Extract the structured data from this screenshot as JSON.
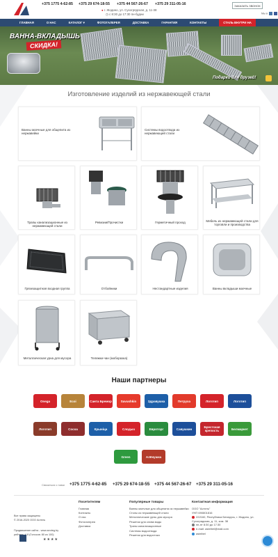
{
  "header": {
    "phones": [
      "+375 1775 4-62-85",
      "+375 29 674-18-55",
      "+375 44 567-26-67",
      "+375 29 311-05-16"
    ],
    "address": "г. Жодино, ул. Сухогрядская, д. 11-38",
    "hours": "с 8:30 до 17:30 пн-будни",
    "callback_label": "ЗАКАЗАТЬ ЗВОНОК",
    "social_label": "Мы в"
  },
  "nav": {
    "items": [
      "ГЛАВНАЯ",
      "О НАС",
      "КАТАЛОГ ▾",
      "ФОТОГАЛЕРЕЯ",
      "ДОСТАВКА",
      "ГАРАНТИЯ",
      "КОНТАКТЫ"
    ],
    "sale": "СТАЛЬ ВНУТРИ НА"
  },
  "hero": {
    "title": "ВАННА-ВКЛАДЫШЬ",
    "badge": "СКИДКА!",
    "gift_text": "Подарки для друзей!"
  },
  "section_title": "Изготовление изделий из нержавеющей стали",
  "products": [
    "Ванны моечные для общепита из нержавейки",
    "Системы водоотвода из нержавеющей стали",
    "Трапы канализационные из нержавеющей стали",
    "Ревизии/Прочистки",
    "Герметичный проход",
    "Мебель из нержавеющей стали для торговли и производства",
    "Грязезащитная входная группа",
    "Отбойники",
    "Нестандартные изделия",
    "Ванны вкладыши моечные",
    "Металлическая урна для мусора",
    "Тележки-чан (моборазка)"
  ],
  "partners_title": "Наши партнеры",
  "partners": [
    "Onega",
    "Ecoi",
    "Санта Бремор",
    "Savushkin",
    "Здравушка",
    "Петруха",
    "Логотип",
    "Логотип",
    "Логотип",
    "Cocoa",
    "Крыніца",
    "Слодыч",
    "Евроторг",
    "Савушкин",
    "Брестская крепость",
    "Белмаркет",
    "Green",
    "Алёнушка"
  ],
  "partner_colors": [
    "#d4232a",
    "#b7843a",
    "#d4232a",
    "#e63a2c",
    "#1d5fa8",
    "#e23a2b",
    "#d4232a",
    "#1d4f9a",
    "#8a3b2a",
    "#8e2d2d",
    "#1d5fa8",
    "#d4232a",
    "#2a8c3e",
    "#1d4f9a",
    "#c4262d",
    "#3a9a3a",
    "#2e9a3e",
    "#b33b2a"
  ],
  "footer": {
    "phones_label": "Связаться с нами",
    "phones": [
      "+375 1775 4-62-85",
      "+375 29 674-18-55",
      "+375 44 567-26-67",
      "+375 29 311-05-16"
    ],
    "copyright": [
      "Все права защищены",
      "© 2016-2020 ООО Астель"
    ],
    "dev": [
      "Продвижение сайта - www.seoteg.by",
      "рейтинг: 4.8 (Голосов: 80 из 100)"
    ],
    "stars": "★★★★",
    "visitors_title": "Посетителям",
    "visitors": [
      "Главная",
      "Контакты",
      "О нас",
      "Фотогалерея",
      "Доставка"
    ],
    "popular_title": "Популярные товары",
    "popular": [
      "Ванны моечные для общепита из нержавейки",
      "Столы из нержавеющей стали",
      "Металлические урны для мусора",
      "Решетки для слива воды",
      "Трапы канализационные",
      "Системы водоотвода",
      "Решетки для водостока"
    ],
    "contact_title": "Контактная информация",
    "contact": [
      "ООО \"Астель\"",
      "УНП 690801816",
      "222160, Республика Беларусь, г. Жодино, ул. Сухогрядская, д. 11, ком. 38",
      "пн-пт 8:30 до 17:30",
      "e-mail: astelbel@mail.com",
      "astelbel"
    ]
  }
}
